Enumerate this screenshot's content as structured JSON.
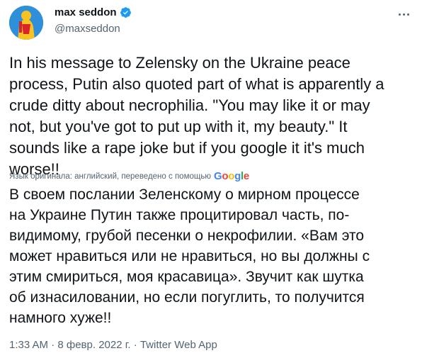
{
  "author": {
    "display_name": "max seddon",
    "handle": "@maxseddon",
    "verified_icon": "verified-badge-icon"
  },
  "tweet": {
    "text": "In his message to Zelensky on the Ukraine peace\nprocess, Putin also quoted part of what is apparently a\ncrude ditty about necrophilia. \"You may like it or may\nnot, but you've got to put up with it, my beauty.\" It\nsounds like a rape joke but if you google it it's much\nworse!!",
    "translation_note": "Язык оригинала: английский, переведено с помощью",
    "translation_provider": "Google",
    "translated_text": "В своем послании Зеленскому о мирном процессе\nна Украине Путин также процитировал часть, по-\nвидимому, грубой песенки о некрофилии. «Вам это\nможет нравиться или не нравиться, но вы должны с\nэтим смириться, моя красавица». Звучит как шутка\nоб изнасиловании, но если погуглить, то получится\nнамного хуже!!"
  },
  "meta": {
    "timestamp": "1:33 AM · 8 февр. 2022 г. · Twitter Web App"
  },
  "colors": {
    "text_primary": "#0f1419",
    "text_secondary": "#536471",
    "verified_blue": "#1d9bf0"
  }
}
